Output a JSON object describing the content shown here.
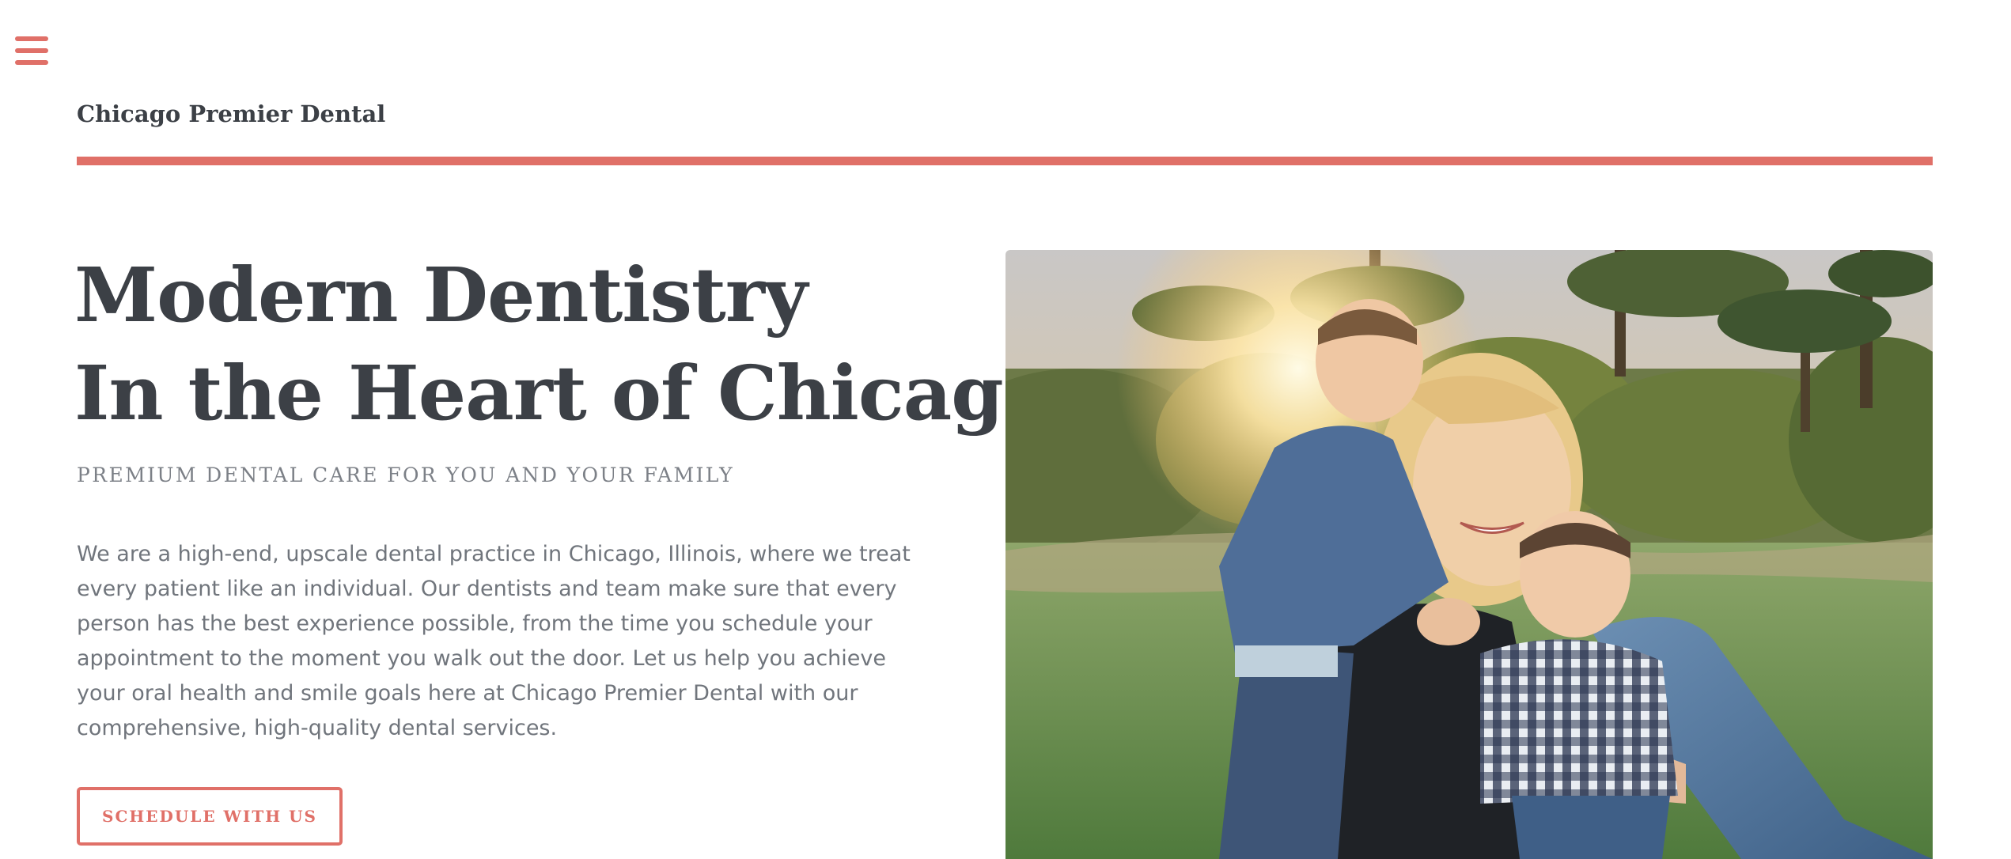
{
  "nav": {
    "menu_icon": "hamburger-menu-icon"
  },
  "header": {
    "site_title": "Chicago Premier Dental",
    "accent_color": "#e07068"
  },
  "hero": {
    "heading_line_1": "Modern Dentistry",
    "heading_line_2": "In the Heart of Chicago",
    "subtitle": "PREMIUM DENTAL CARE FOR YOU AND YOUR FAMILY",
    "body": "We are a high-end, upscale dental practice in Chicago, Illinois, where we treat every patient like an individual. Our dentists and team make sure that every person has the best experience possible, from the time you schedule your appointment to the moment you walk out the door. Let us help you achieve your oral health and smile goals here at Chicago Premier Dental with our comprehensive, high-quality dental services.",
    "cta_label": "SCHEDULE WITH US",
    "image_alt": "Mother sitting on grass with two young children at sunset"
  },
  "colors": {
    "accent": "#e07068",
    "heading": "#3c4046",
    "subtitle": "#7c8087",
    "body": "#70757c"
  }
}
